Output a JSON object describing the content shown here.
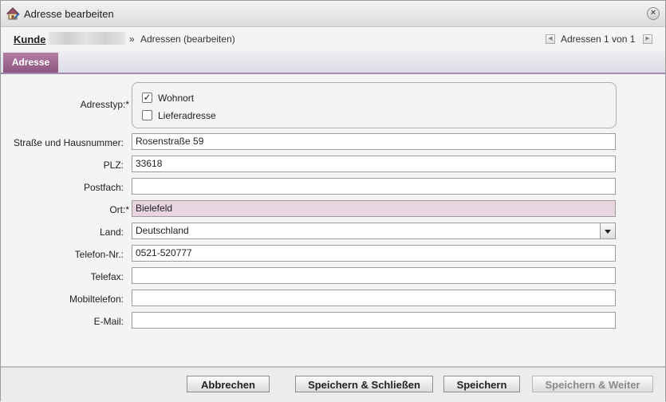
{
  "window": {
    "title": "Adresse bearbeiten",
    "close_symbol": "×"
  },
  "breadcrumb": {
    "root_label": "Kunde",
    "separator": "»",
    "current": "Adressen (bearbeiten)",
    "pager_text": "Adressen 1 von 1",
    "prev_symbol": "◀",
    "next_symbol": "▶"
  },
  "tabs": [
    {
      "label": "Adresse",
      "active": true
    }
  ],
  "form": {
    "address_type": {
      "label": "Adresstyp:*",
      "options": [
        {
          "label": "Wohnort",
          "checked": true,
          "mark": "✓"
        },
        {
          "label": "Lieferadresse",
          "checked": false,
          "mark": ""
        }
      ]
    },
    "street": {
      "label": "Straße und Hausnummer:",
      "value": "Rosenstraße 59"
    },
    "zip": {
      "label": "PLZ:",
      "value": "33618"
    },
    "pobox": {
      "label": "Postfach:",
      "value": ""
    },
    "city": {
      "label": "Ort:*",
      "value": "Bielefeld",
      "required_color": "#e9d5e0"
    },
    "country": {
      "label": "Land:",
      "value": "Deutschland"
    },
    "phone": {
      "label": "Telefon-Nr.:",
      "value": "0521-520777"
    },
    "fax": {
      "label": "Telefax:",
      "value": ""
    },
    "mobile": {
      "label": "Mobiltelefon:",
      "value": ""
    },
    "email": {
      "label": "E-Mail:",
      "value": ""
    }
  },
  "footer": {
    "cancel": "Abbrechen",
    "save_close": "Speichern & Schließen",
    "save": "Speichern",
    "save_next": "Speichern & Weiter"
  },
  "colors": {
    "tab_accent": "#8d5580",
    "required_field": "#e9d5e0"
  }
}
